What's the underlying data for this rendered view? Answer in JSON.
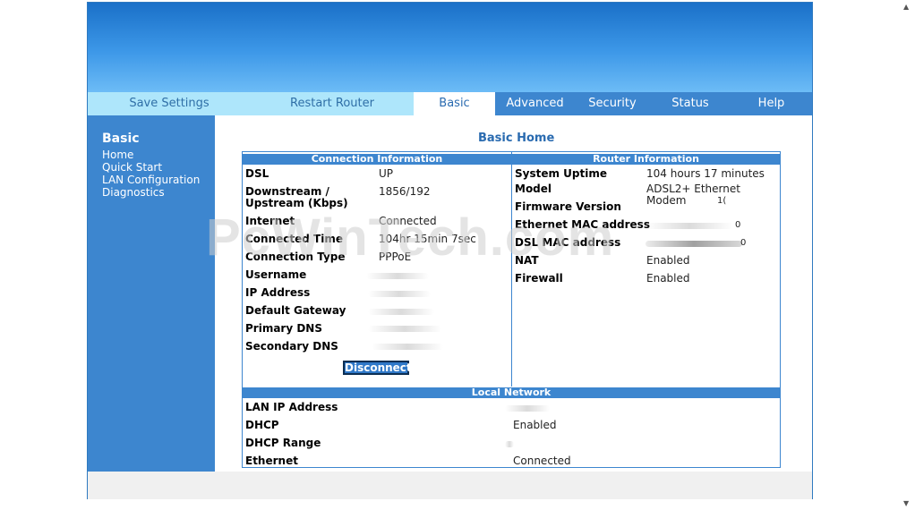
{
  "nav": {
    "save_settings": "Save Settings",
    "restart_router": "Restart Router",
    "basic": "Basic",
    "advanced": "Advanced",
    "security": "Security",
    "status": "Status",
    "help": "Help"
  },
  "sidebar": {
    "title": "Basic",
    "items": [
      "Home",
      "Quick Start",
      "LAN Configuration",
      "Diagnostics"
    ]
  },
  "main": {
    "title": "Basic Home"
  },
  "connection": {
    "header": "Connection Information",
    "dsl_label": "DSL",
    "dsl_value": "UP",
    "downstream_label": "Downstream /",
    "upstream_label": "Upstream (Kbps)",
    "stream_value": "1856/192",
    "internet_label": "Internet",
    "internet_value": "Connected",
    "connected_time_label": "Connected Time",
    "connected_time_value": "104hr 15min 7sec",
    "connection_type_label": "Connection Type",
    "connection_type_value": "PPPoE",
    "username_label": "Username",
    "ip_address_label": "IP Address",
    "default_gateway_label": "Default Gateway",
    "primary_dns_label": "Primary DNS",
    "secondary_dns_label": "Secondary DNS",
    "disconnect_button": "Disconnect"
  },
  "router": {
    "header": "Router Information",
    "uptime_label": "System Uptime",
    "uptime_value": "104 hours 17 minutes",
    "model_label": "Model",
    "model_value": "ADSL2+ Ethernet Modem",
    "firmware_label": "Firmware Version",
    "firmware_fragment": "1(",
    "eth_mac_label": "Ethernet MAC address",
    "eth_mac_fragment": "0",
    "dsl_mac_label": "DSL MAC address",
    "dsl_mac_fragment": "0",
    "nat_label": "NAT",
    "nat_value": "Enabled",
    "firewall_label": "Firewall",
    "firewall_value": "Enabled"
  },
  "local": {
    "header": "Local Network",
    "lan_ip_label": "LAN IP Address",
    "dhcp_label": "DHCP",
    "dhcp_value": "Enabled",
    "dhcp_range_label": "DHCP Range",
    "ethernet_label": "Ethernet",
    "ethernet_value": "Connected"
  },
  "watermark": "PcWinTech.com",
  "colors": {
    "accent": "#3d86cf",
    "nav_light": "#aee6fb",
    "title_blue": "#2a6bb0"
  }
}
